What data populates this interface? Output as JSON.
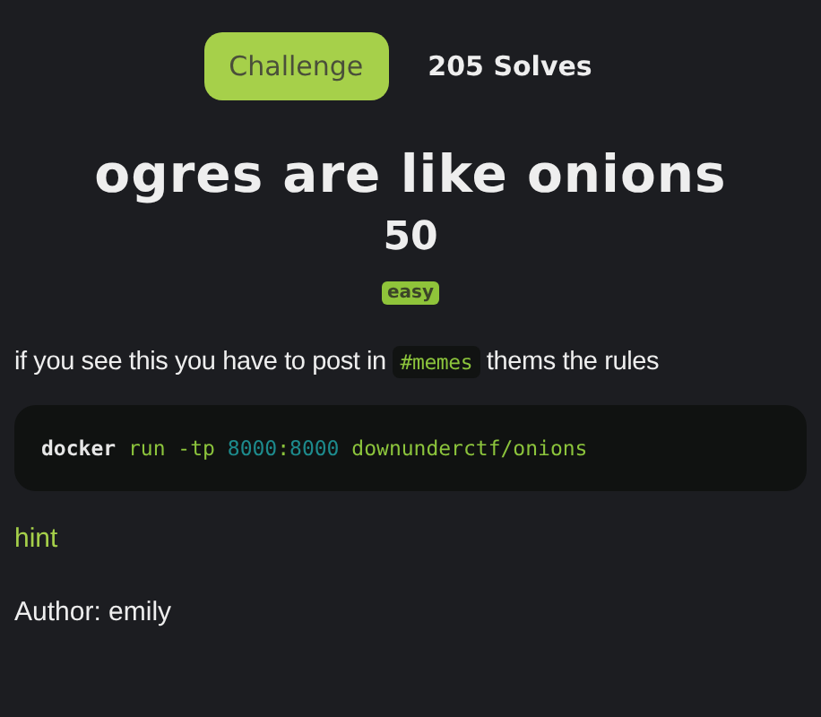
{
  "tabs": [
    {
      "label": "Challenge",
      "selected": true
    },
    {
      "label": "205 Solves",
      "selected": false
    }
  ],
  "title": "ogres are like onions",
  "points": "50",
  "difficulty": "easy",
  "description": [
    {
      "kind": "text",
      "text": "if you see this you have to post in "
    },
    {
      "kind": "code",
      "text": "#memes"
    },
    {
      "kind": "text",
      "text": " thems the rules"
    }
  ],
  "code_block": [
    [
      {
        "kind": "command",
        "text": "docker"
      }
    ],
    [
      {
        "kind": "arg",
        "text": "run -tp"
      }
    ],
    [
      {
        "kind": "number",
        "text": "8000"
      },
      {
        "kind": "arg",
        "text": ":"
      },
      {
        "kind": "number",
        "text": "8000"
      }
    ],
    [
      {
        "kind": "arg",
        "text": "downunderctf/onions"
      }
    ]
  ],
  "hint_link": "hint",
  "author": "Author: emily"
}
